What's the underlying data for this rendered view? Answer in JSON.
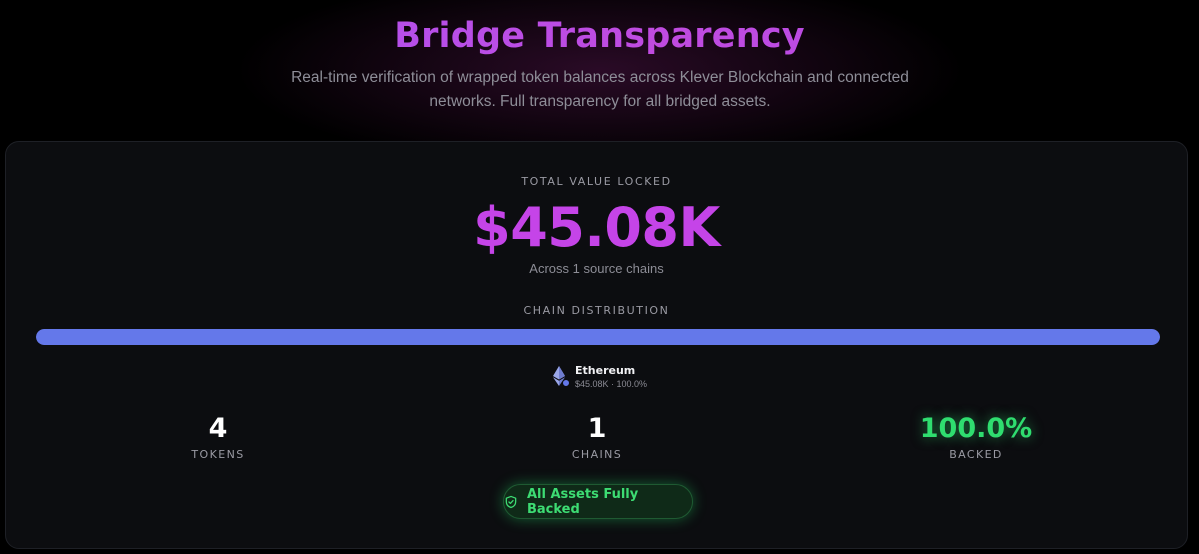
{
  "hero": {
    "title": "Bridge Transparency",
    "subtitle": "Real-time verification of wrapped token balances across Klever Blockchain and connected networks. Full transparency for all bridged assets."
  },
  "tvl": {
    "label": "TOTAL VALUE LOCKED",
    "value": "$45.08K",
    "subtitle": "Across 1 source chains"
  },
  "distribution": {
    "label": "CHAIN DISTRIBUTION",
    "chains": [
      {
        "name": "Ethereum",
        "value_text": "$45.08K · 100.0%",
        "share": 1.0,
        "color": "#6478ea",
        "icon": "ethereum-icon"
      }
    ]
  },
  "stats": [
    {
      "value": "4",
      "label": "TOKENS"
    },
    {
      "value": "1",
      "label": "CHAINS"
    },
    {
      "value": "100.0%",
      "label": "BACKED",
      "color": "#2fdd6f"
    }
  ],
  "badge": {
    "label": "All Assets Fully Backed",
    "icon": "shield-check-icon",
    "color": "#3ddc73"
  },
  "colors": {
    "accent": "#c544e8",
    "title_gradient_start": "#a855f7",
    "success": "#2fdd6f"
  }
}
